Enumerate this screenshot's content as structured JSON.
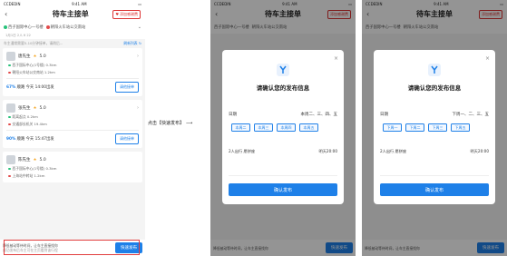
{
  "status": {
    "carrier": "CCDEDIN",
    "time": "9:41 AM"
  },
  "nav": {
    "back": "‹",
    "title": "待车主接单",
    "tag": "添加感谢费"
  },
  "route": {
    "from": "西子国际中心一号楼",
    "to": "朝阳火车站公交南站",
    "sub": "1月1日  2人  ¥ 22"
  },
  "hint": {
    "left": "车主通常需要5-10分钟接单，请稍后...",
    "right": "刷新列表 ↻"
  },
  "cards": [
    {
      "name": "唐先生",
      "rating": "5.0",
      "loc1": "西子国际中心(1号楼)  0.3km",
      "loc2": "朝阳火车站公交南站  1.2km",
      "pct": "67%",
      "pct_label": "顺路",
      "time": "今天 14:00出发",
      "btn": "请他接单"
    },
    {
      "name": "张先生",
      "rating": "5.0",
      "loc1": "距离起点  0.2km",
      "loc2": "交通部长机关  19.4km",
      "pct": "90%",
      "pct_label": "顺路",
      "time": "今天 15:47出发",
      "btn": "请他接单"
    },
    {
      "name": "陈先生",
      "rating": "5.0",
      "loc1": "西子国际中心(1号楼)  0.3km",
      "loc2": "上海站中转站  1.2km",
      "pct": "",
      "pct_label": "",
      "time": "",
      "btn": ""
    }
  ],
  "footer": {
    "line1": "降低被动等待时间，让车主直接找你",
    "line2": "成功发布后车主可在主页看到该行程",
    "btn": "快速发布"
  },
  "annotation": "点击【快速发布】",
  "modal": {
    "title": "请确认您的发布信息",
    "day_label": "日期",
    "day_value": "本周二、三、四、五",
    "chips": [
      "本周二",
      "本周三",
      "本周四",
      "本周五"
    ],
    "chips3": [
      "下周一",
      "下周二",
      "下周三",
      "下周五"
    ],
    "day_value3": "下周一、二、三、五",
    "people": "2人出行  愿拼座",
    "time": "明天20:00",
    "confirm": "确认发布"
  },
  "colors": {
    "accent": "#1e80e8",
    "alert": "#e23d3d",
    "star": "#f5a623"
  }
}
